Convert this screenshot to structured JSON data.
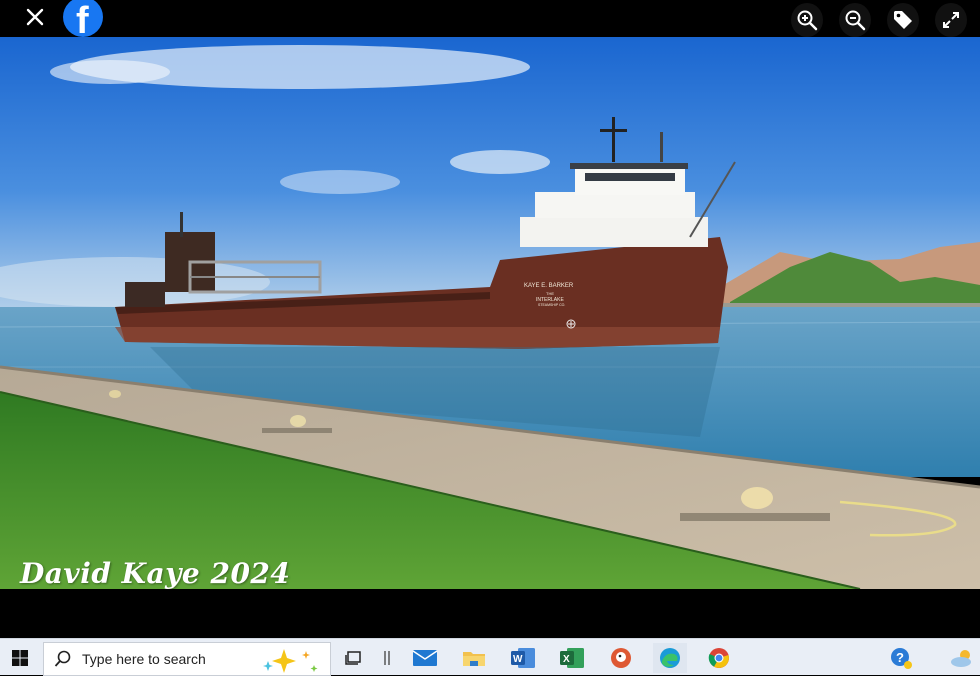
{
  "viewer": {
    "icons": [
      "close-icon",
      "facebook-logo",
      "zoom-in-icon",
      "zoom-out-icon",
      "tag-icon",
      "fullscreen-icon"
    ]
  },
  "photo": {
    "ship_name": "KAYE E. BARKER",
    "ship_line1": "THE",
    "ship_line2": "INTERLAKE",
    "ship_line3": "STEAMSHIP CO.",
    "watermark": "David Kaye 2024"
  },
  "taskbar": {
    "search_placeholder": "Type here to search",
    "apps": [
      "task-view",
      "separator",
      "mail",
      "file-explorer",
      "word",
      "excel",
      "duckduckgo",
      "edge",
      "chrome"
    ],
    "tray": [
      "help-icon",
      "weather-icon"
    ]
  },
  "colors": {
    "facebook_blue": "#1877f2",
    "sky_top": "#1e6fd6",
    "water": "#4a8fb5",
    "hull": "#5a2a1e",
    "grass": "#3f8a2a",
    "taskbar": "#e9eef6"
  }
}
